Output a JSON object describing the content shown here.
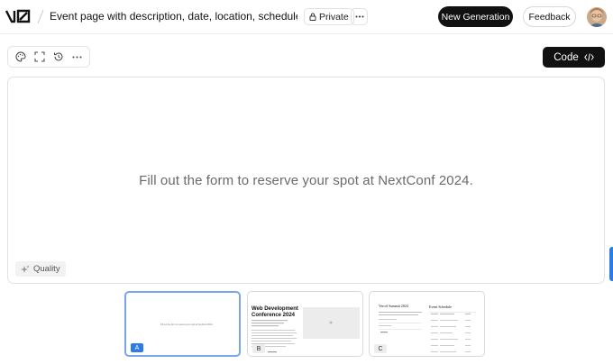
{
  "header": {
    "title": "Event page with description, date, location, schedule wit…",
    "private_label": "Private",
    "new_generation_label": "New Generation",
    "feedback_label": "Feedback"
  },
  "toolbar": {
    "code_label": "Code"
  },
  "preview": {
    "message": "Fill out the form to reserve your spot at NextConf 2024.",
    "quality_label": "Quality"
  },
  "thumbnails": [
    {
      "letter": "A",
      "selected": true,
      "caption": "Fill out the form to reserve your spot at NextConf 2024."
    },
    {
      "letter": "B",
      "selected": false,
      "title": "Web Development Conference 2024"
    },
    {
      "letter": "C",
      "selected": false,
      "title": "Vercel Summit 2024",
      "side_title": "Event Schedule"
    }
  ],
  "colors": {
    "accent_blue": "#2f7be6",
    "primary_button": "#111111",
    "border": "#e2e2e2"
  },
  "icons": [
    "v0-logo",
    "lock-icon",
    "ellipsis-icon",
    "palette-icon",
    "fullscreen-icon",
    "history-icon",
    "more-icon",
    "code-icon",
    "sparkle-icon"
  ]
}
